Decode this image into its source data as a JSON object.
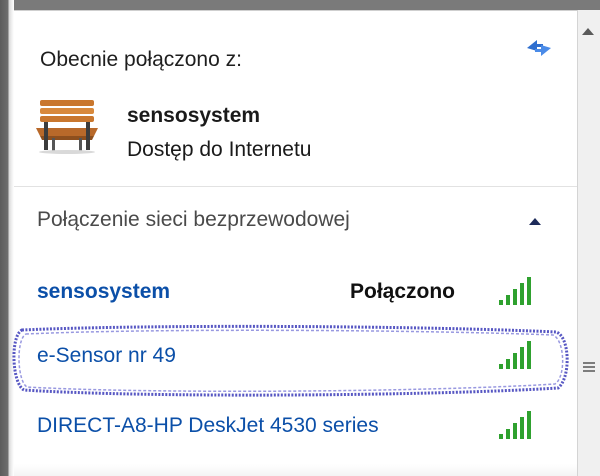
{
  "current": {
    "label": "Obecnie połączono z:",
    "network_name": "sensosystem",
    "network_status": "Dostęp do Internetu",
    "icon": "bench-icon",
    "refresh_icon": "refresh-icon"
  },
  "wireless": {
    "section_label": "Połączenie sieci bezprzewodowej",
    "collapse_icon": "chevron-up-icon",
    "networks": [
      {
        "name": "sensosystem",
        "status": "Połączono",
        "signal_bars": 5,
        "connected": true
      },
      {
        "name": "e-Sensor nr 49",
        "status": "",
        "signal_bars": 5,
        "connected": false,
        "highlighted": true
      },
      {
        "name": "DIRECT-A8-HP DeskJet 4530 series",
        "status": "",
        "signal_bars": 5,
        "connected": false
      }
    ]
  },
  "colors": {
    "link_blue": "#0b4fa8",
    "signal_green": "#2fa12f",
    "marker_blue": "#3a3ab8"
  }
}
